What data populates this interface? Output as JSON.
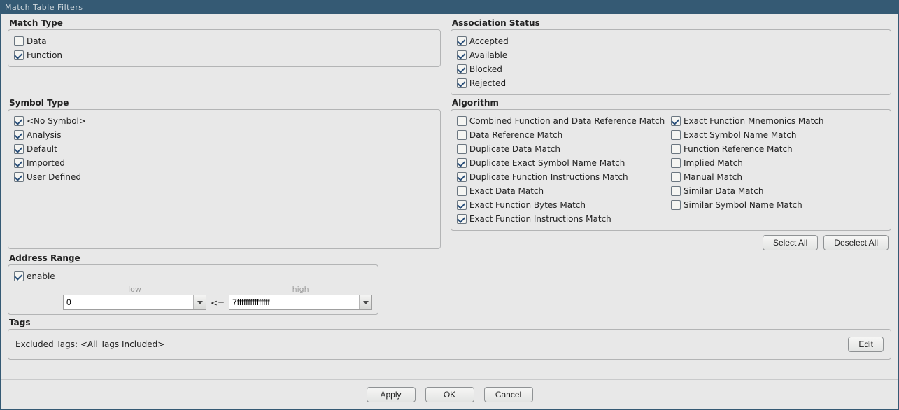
{
  "window": {
    "title": "Match Table Filters"
  },
  "matchType": {
    "title": "Match Type",
    "items": [
      {
        "label": "Data",
        "checked": false
      },
      {
        "label": "Function",
        "checked": true
      }
    ]
  },
  "associationStatus": {
    "title": "Association Status",
    "items": [
      {
        "label": "Accepted",
        "checked": true
      },
      {
        "label": "Available",
        "checked": true
      },
      {
        "label": "Blocked",
        "checked": true
      },
      {
        "label": "Rejected",
        "checked": true
      }
    ]
  },
  "symbolType": {
    "title": "Symbol Type",
    "items": [
      {
        "label": "<No Symbol>",
        "checked": true
      },
      {
        "label": "Analysis",
        "checked": true
      },
      {
        "label": "Default",
        "checked": true
      },
      {
        "label": "Imported",
        "checked": true
      },
      {
        "label": "User Defined",
        "checked": true
      }
    ]
  },
  "algorithm": {
    "title": "Algorithm",
    "left": [
      {
        "label": "Combined Function and Data Reference Match",
        "checked": false
      },
      {
        "label": "Data Reference Match",
        "checked": false
      },
      {
        "label": "Duplicate Data Match",
        "checked": false
      },
      {
        "label": "Duplicate Exact Symbol Name Match",
        "checked": true
      },
      {
        "label": "Duplicate Function Instructions Match",
        "checked": true
      },
      {
        "label": "Exact Data Match",
        "checked": false
      },
      {
        "label": "Exact Function Bytes Match",
        "checked": true
      },
      {
        "label": "Exact Function Instructions Match",
        "checked": true
      }
    ],
    "right": [
      {
        "label": "Exact Function Mnemonics Match",
        "checked": true
      },
      {
        "label": "Exact Symbol Name Match",
        "checked": false
      },
      {
        "label": "Function Reference Match",
        "checked": false
      },
      {
        "label": "Implied Match",
        "checked": false
      },
      {
        "label": "Manual Match",
        "checked": false
      },
      {
        "label": "Similar Data Match",
        "checked": false
      },
      {
        "label": "Similar Symbol Name Match",
        "checked": false
      }
    ],
    "selectAll": "Select All",
    "deselectAll": "Deselect All"
  },
  "addressRange": {
    "title": "Address Range",
    "enableLabel": "enable",
    "enableChecked": true,
    "lowLabel": "low",
    "highLabel": "high",
    "lowValue": "0",
    "highValue": "7fffffffffffffff",
    "operator": "<="
  },
  "tags": {
    "title": "Tags",
    "text": "Excluded Tags: <All Tags Included>",
    "editLabel": "Edit"
  },
  "footer": {
    "apply": "Apply",
    "ok": "OK",
    "cancel": "Cancel"
  }
}
